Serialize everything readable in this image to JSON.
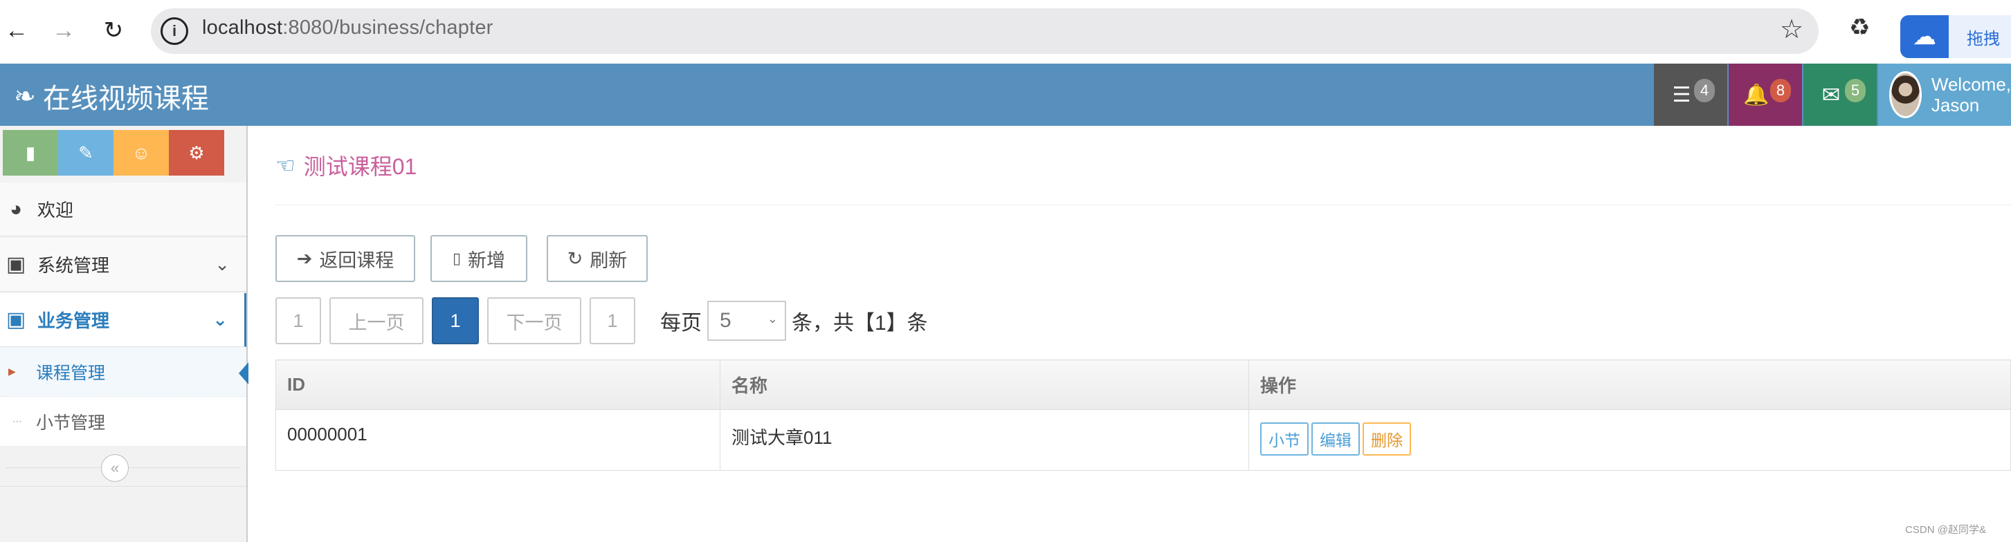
{
  "browser": {
    "url_host": "localhost",
    "url_rest": ":8080/business/chapter",
    "ext_label": "拖拽"
  },
  "navbar": {
    "brand": "在线视频课程",
    "tasks_count": "4",
    "notify_count": "8",
    "messages_count": "5",
    "welcome": "Welcome,",
    "user_name": "Jason"
  },
  "sidebar": {
    "welcome": "欢迎",
    "system": "系统管理",
    "business": "业务管理",
    "sub_course": "课程管理",
    "sub_section": "小节管理"
  },
  "main": {
    "page_title": "测试课程01",
    "btn_back": "返回课程",
    "btn_add": "新增",
    "btn_refresh": "刷新",
    "pager": {
      "first": "1",
      "prev": "上一页",
      "current": "1",
      "next": "下一页",
      "last": "1",
      "per_page_label": "每页",
      "per_page_value": "5",
      "total_text": "条，共【1】条"
    },
    "table": {
      "headers": [
        "ID",
        "名称",
        "操作"
      ],
      "rows": [
        {
          "id": "00000001",
          "name": "测试大章011"
        }
      ],
      "ops": [
        "小节",
        "编辑",
        "删除"
      ]
    }
  },
  "watermark": "CSDN @赵同学&"
}
